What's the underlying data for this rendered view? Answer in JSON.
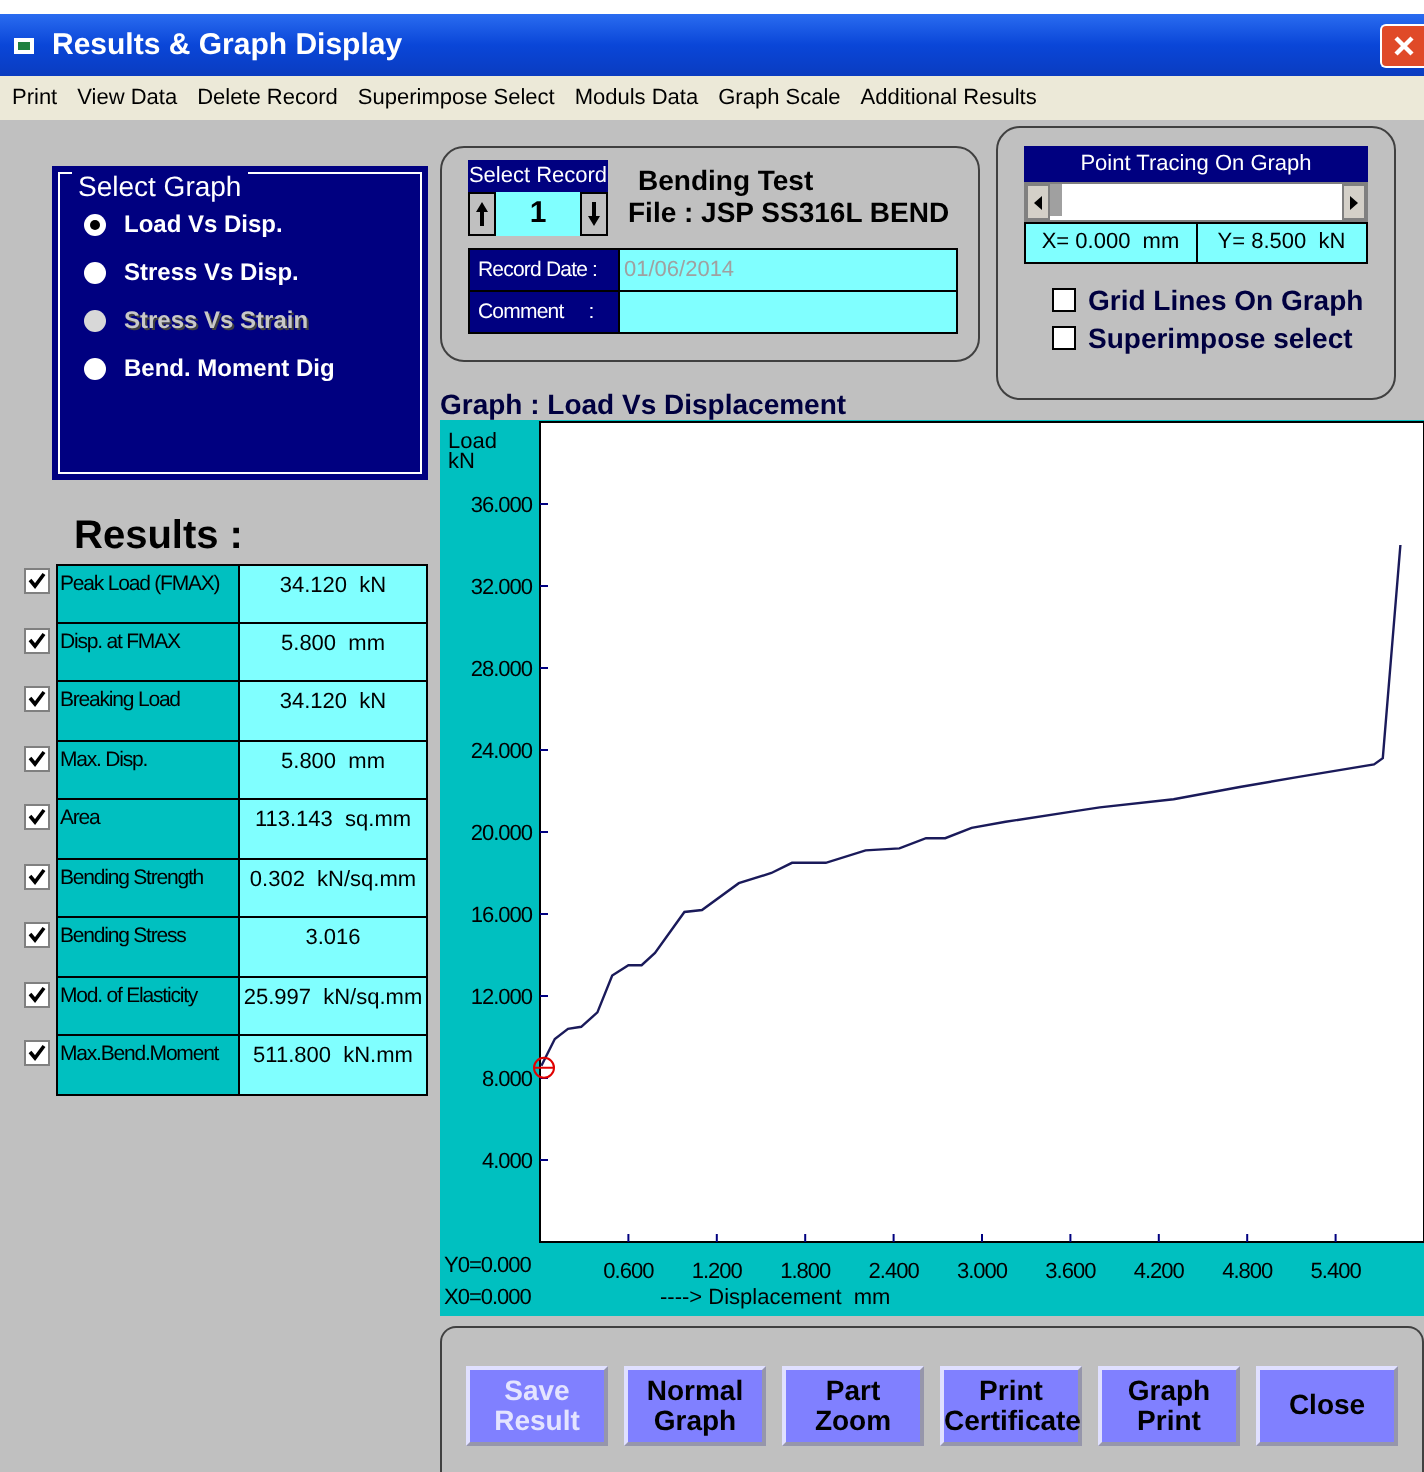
{
  "window": {
    "title": "Results & Graph Display"
  },
  "menu": [
    "Print",
    "View Data",
    "Delete Record",
    "Superimpose Select",
    "Moduls Data",
    "Graph Scale",
    "Additional Results"
  ],
  "select_graph": {
    "title": "Select Graph",
    "options": [
      {
        "label": "Load Vs Disp.",
        "selected": true,
        "disabled": false
      },
      {
        "label": "Stress Vs Disp.",
        "selected": false,
        "disabled": false
      },
      {
        "label": "Stress Vs Strain",
        "selected": false,
        "disabled": true
      },
      {
        "label": "Bend. Moment Dig",
        "selected": false,
        "disabled": false
      }
    ]
  },
  "results": {
    "title": "Results :",
    "rows": [
      {
        "label": "Peak Load (FMAX)",
        "value": "34.120  kN",
        "checked": true
      },
      {
        "label": "Disp. at FMAX",
        "value": "5.800  mm",
        "checked": true
      },
      {
        "label": "Breaking Load",
        "value": "34.120  kN",
        "checked": true
      },
      {
        "label": "Max. Disp.",
        "value": "5.800  mm",
        "checked": true
      },
      {
        "label": "Area",
        "value": "113.143  sq.mm",
        "checked": true
      },
      {
        "label": "Bending Strength",
        "value": "0.302  kN/sq.mm",
        "checked": true
      },
      {
        "label": "Bending Stress",
        "value": "3.016",
        "checked": true
      },
      {
        "label": "Mod. of Elasticity",
        "value": "25.997  kN/sq.mm",
        "checked": true
      },
      {
        "label": "Max.Bend.Moment",
        "value": "511.800  kN.mm",
        "checked": true
      }
    ]
  },
  "record": {
    "select_label": "Select Record",
    "number": "1",
    "test": "Bending Test",
    "file": "File : JSP SS316L BEND",
    "date_label": "Record Date :",
    "date": "01/06/2014",
    "comment_label": "Comment     :"
  },
  "tracing": {
    "title": "Point Tracing On Graph",
    "x": "X= 0.000  mm",
    "y": "Y= 8.500  kN",
    "options": [
      {
        "label": "Grid Lines On Graph",
        "checked": false
      },
      {
        "label": "Superimpose select",
        "checked": false
      }
    ]
  },
  "graph": {
    "origin_y": "Y0=0.000",
    "origin_x": "X0=0.000",
    "chart_data": {
      "type": "line",
      "title": "Graph :  Load Vs Displacement",
      "ylabel": "Load kN",
      "xlabel": "----> Displacement  mm",
      "xlim": [
        0,
        6
      ],
      "ylim": [
        0,
        40
      ],
      "xticks": [
        {
          "value": 0.6,
          "label": "0.600"
        },
        {
          "value": 1.2,
          "label": "1.200"
        },
        {
          "value": 1.8,
          "label": "1.800"
        },
        {
          "value": 2.4,
          "label": "2.400"
        },
        {
          "value": 3.0,
          "label": "3.000"
        },
        {
          "value": 3.6,
          "label": "3.600"
        },
        {
          "value": 4.2,
          "label": "4.200"
        },
        {
          "value": 4.8,
          "label": "4.800"
        },
        {
          "value": 5.4,
          "label": "5.400"
        }
      ],
      "yticks": [
        {
          "value": 4,
          "label": "4.000"
        },
        {
          "value": 8,
          "label": "8.000"
        },
        {
          "value": 12,
          "label": "12.000"
        },
        {
          "value": 16,
          "label": "16.000"
        },
        {
          "value": 20,
          "label": "20.000"
        },
        {
          "value": 24,
          "label": "24.000"
        },
        {
          "value": 28,
          "label": "28.000"
        },
        {
          "value": 32,
          "label": "32.000"
        },
        {
          "value": 36,
          "label": "36.000"
        }
      ],
      "x": [
        0.01,
        0.1,
        0.19,
        0.28,
        0.39,
        0.49,
        0.6,
        0.69,
        0.78,
        0.98,
        1.1,
        1.35,
        1.57,
        1.71,
        1.94,
        2.21,
        2.44,
        2.62,
        2.75,
        2.93,
        3.16,
        3.61,
        3.8,
        4.3,
        4.75,
        5.16,
        5.66,
        5.72,
        5.84
      ],
      "series": [
        {
          "color": "#1a1a5a",
          "values": [
            8.6,
            9.9,
            10.4,
            10.5,
            11.2,
            13.0,
            13.5,
            13.5,
            14.1,
            16.1,
            16.2,
            17.5,
            18.0,
            18.5,
            18.5,
            19.1,
            19.2,
            19.7,
            19.7,
            20.2,
            20.5,
            21.0,
            21.2,
            21.6,
            22.2,
            22.7,
            23.3,
            23.6,
            34.0
          ]
        }
      ]
    }
  },
  "buttons": [
    {
      "label": "Save Result",
      "disabled": true
    },
    {
      "label": "Normal Graph",
      "disabled": false
    },
    {
      "label": "Part Zoom",
      "disabled": false
    },
    {
      "label": "Print Certificate",
      "disabled": false
    },
    {
      "label": "Graph Print",
      "disabled": false
    },
    {
      "label": "Close",
      "disabled": false
    }
  ]
}
